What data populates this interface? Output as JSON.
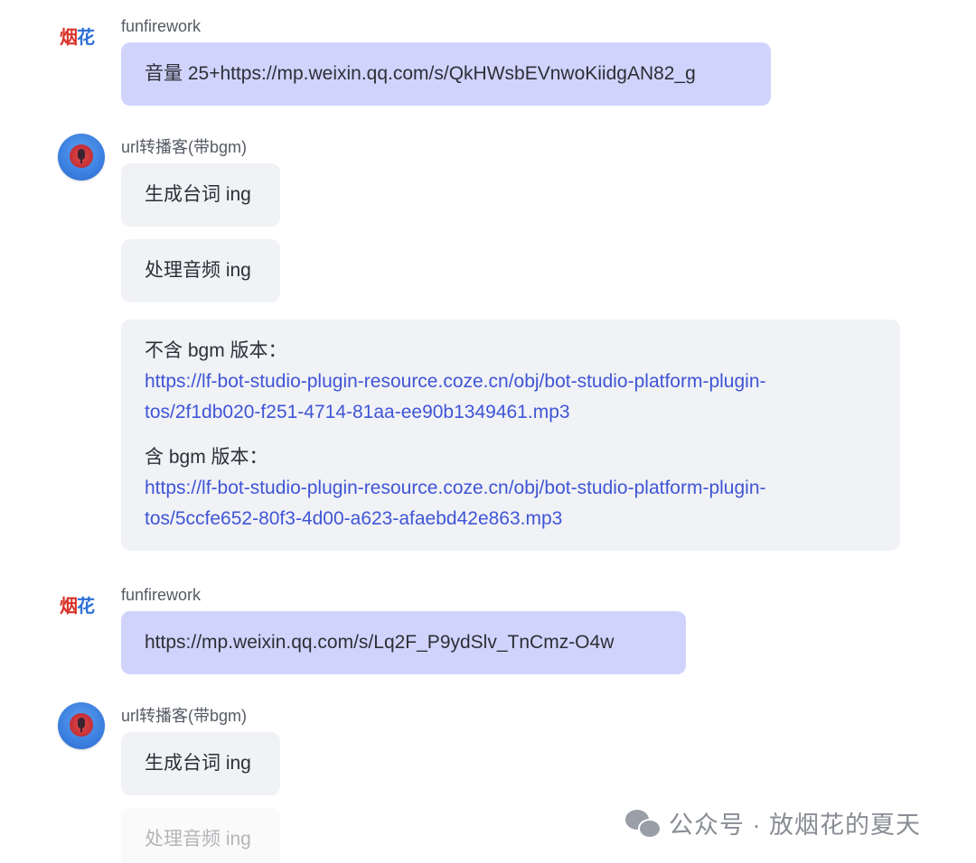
{
  "messages": [
    {
      "sender": "funfirework",
      "avatar_text": [
        "烟",
        "花"
      ],
      "bubbles": [
        "音量 25+https://mp.weixin.qq.com/s/QkHWsbEVnwoKiidgAN82_g"
      ]
    },
    {
      "sender": "url转播客(带bgm)",
      "bubbles": [
        "生成台词 ing",
        "处理音频 ing"
      ],
      "result": {
        "no_bgm_label": "不含 bgm 版本：",
        "no_bgm_url_line1": "https://lf-bot-studio-plugin-resource.coze.cn/obj/bot-studio-platform-plugin-",
        "no_bgm_url_line2": "tos/2f1db020-f251-4714-81aa-ee90b1349461.mp3",
        "bgm_label": "含 bgm 版本：",
        "bgm_url_line1": "https://lf-bot-studio-plugin-resource.coze.cn/obj/bot-studio-platform-plugin-",
        "bgm_url_line2": "tos/5ccfe652-80f3-4d00-a623-afaebd42e863.mp3"
      }
    },
    {
      "sender": "funfirework",
      "avatar_text": [
        "烟",
        "花"
      ],
      "bubbles": [
        "https://mp.weixin.qq.com/s/Lq2F_P9ydSlv_TnCmz-O4w"
      ]
    },
    {
      "sender": "url转播客(带bgm)",
      "bubbles": [
        "生成台词 ing",
        "处理音频 ing"
      ]
    }
  ],
  "watermark": {
    "icon": "wechat-icon",
    "text": "公众号 · 放烟花的夏天"
  },
  "colors": {
    "user_bubble": "#d0d4fd",
    "bot_bubble": "#f1f2f6",
    "link": "#3f55d6"
  }
}
